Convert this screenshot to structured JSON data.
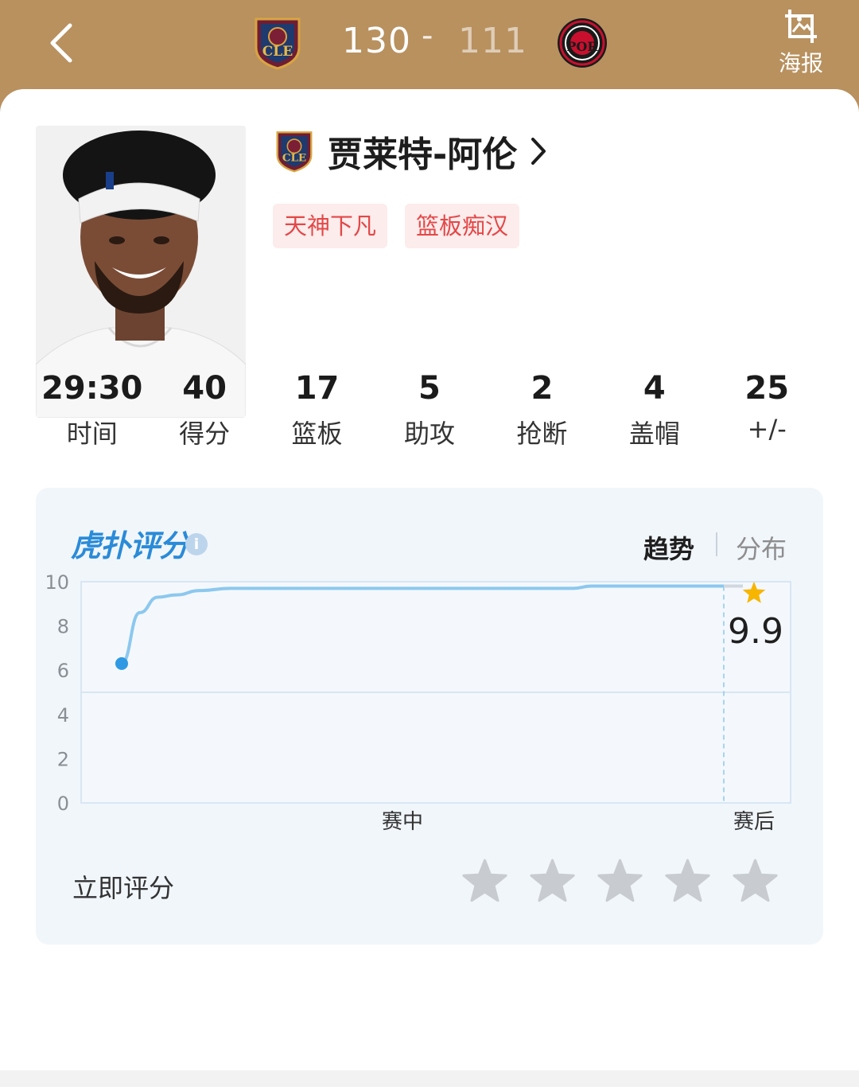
{
  "header": {
    "home_team": "CLE",
    "away_team": "POR",
    "home_score": "130",
    "separator": "-",
    "away_score": "111",
    "poster_label": "海报",
    "colors": {
      "background": "#b8915f",
      "home_logo": "#7a1f35",
      "away_logo": "#c8102e"
    }
  },
  "player": {
    "team": "CLE",
    "name": "贾莱特-阿伦",
    "tags": [
      "天神下凡",
      "篮板痴汉"
    ]
  },
  "stats": [
    {
      "value": "29:30",
      "label": "时间"
    },
    {
      "value": "40",
      "label": "得分"
    },
    {
      "value": "17",
      "label": "篮板"
    },
    {
      "value": "5",
      "label": "助攻"
    },
    {
      "value": "2",
      "label": "抢断"
    },
    {
      "value": "4",
      "label": "盖帽"
    },
    {
      "value": "25",
      "label": "+/-"
    }
  ],
  "rating": {
    "brand": "虎扑评分",
    "registered": "®",
    "info_icon": "info-icon",
    "tabs": [
      {
        "label": "趋势",
        "active": true
      },
      {
        "label": "分布",
        "active": false
      }
    ],
    "rate_now_label": "立即评分",
    "user_stars": 0,
    "max_stars": 5
  },
  "chart_data": {
    "type": "line",
    "ylim": [
      0,
      10
    ],
    "y_ticks": [
      "0",
      "2",
      "4",
      "6",
      "8",
      "10"
    ],
    "x_ticks": [
      "赛中",
      "赛后"
    ],
    "final_score_label": "9.9",
    "series": [
      {
        "values": [
          {
            "t": 0.0,
            "y": 6.3
          },
          {
            "t": 0.03,
            "y": 8.6
          },
          {
            "t": 0.06,
            "y": 9.3
          },
          {
            "t": 0.09,
            "y": 9.4
          },
          {
            "t": 0.13,
            "y": 9.6
          },
          {
            "t": 0.18,
            "y": 9.7
          },
          {
            "t": 0.4,
            "y": 9.7
          },
          {
            "t": 0.75,
            "y": 9.7
          },
          {
            "t": 0.78,
            "y": 9.8
          },
          {
            "t": 1.0,
            "y": 9.8
          }
        ]
      }
    ],
    "final": {
      "y": 9.9
    },
    "colors": {
      "line": "#8cc8ee",
      "start_dot": "#2f9ae3",
      "star": "#f7b500",
      "grid": "#d8e6f3"
    }
  }
}
